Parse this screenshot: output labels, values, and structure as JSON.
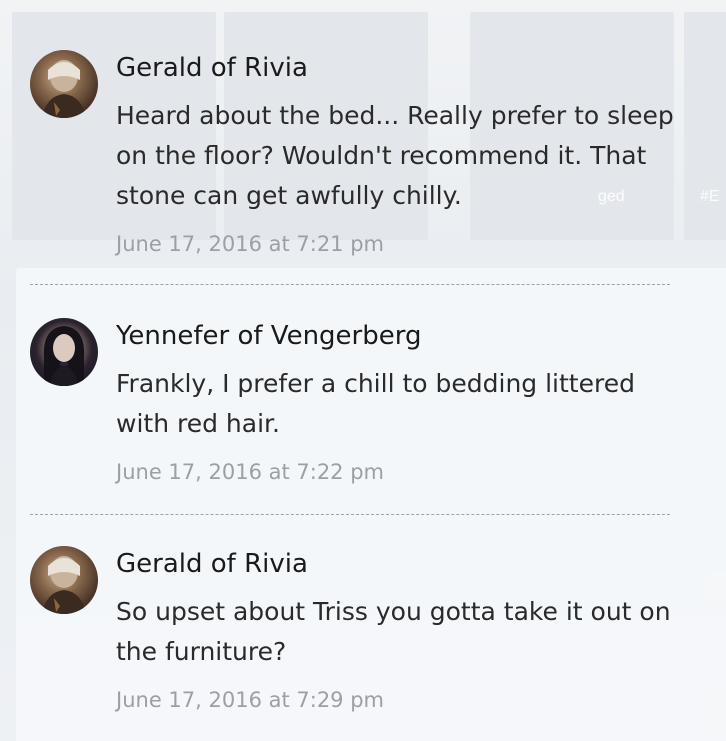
{
  "background": {
    "tiles": [
      "tile-1",
      "tile-2",
      "tile-3",
      "tile-4"
    ],
    "tile_labels": [
      "ged",
      "#E"
    ]
  },
  "comments": [
    {
      "author": "Gerald of Rivia",
      "avatar": "gerald-avatar",
      "text": "Heard about the bed... Really prefer to sleep on the floor? Wouldn't recommend it. That stone can get awfully chilly.",
      "date": "June 17, 2016 at 7:21 pm"
    },
    {
      "author": "Yennefer of Vengerberg",
      "avatar": "yennefer-avatar",
      "text": "Frankly, I prefer a chill to bedding littered with red hair.",
      "date": "June 17, 2016 at 7:22 pm"
    },
    {
      "author": "Gerald of Rivia",
      "avatar": "gerald-avatar",
      "text": "So upset about Triss you gotta take it out on the furniture?",
      "date": "June 17, 2016 at 7:29 pm"
    }
  ],
  "colors": {
    "name": "#1a1a1a",
    "text": "#2a2a2a",
    "date": "#9aa0a6",
    "divider": "#9aa3ad"
  }
}
